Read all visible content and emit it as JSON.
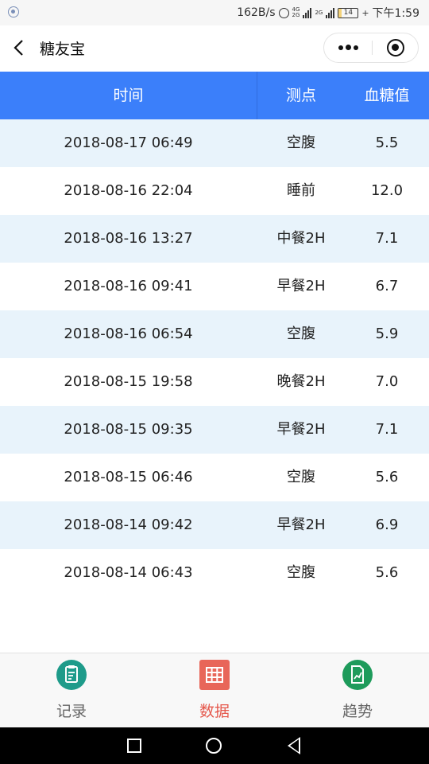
{
  "status_bar": {
    "speed": "162B/s",
    "net_top": "4G",
    "net_bottom": "2G",
    "signal_label": "2G",
    "battery": "14",
    "battery_level": 0.14,
    "time": "下午1:59"
  },
  "header": {
    "title": "糖友宝"
  },
  "table": {
    "columns": [
      "时间",
      "测点",
      "血糖值"
    ],
    "rows": [
      {
        "time": "2018-08-17 06:49",
        "point": "空腹",
        "value": "5.5"
      },
      {
        "time": "2018-08-16 22:04",
        "point": "睡前",
        "value": "12.0"
      },
      {
        "time": "2018-08-16 13:27",
        "point": "中餐2H",
        "value": "7.1"
      },
      {
        "time": "2018-08-16 09:41",
        "point": "早餐2H",
        "value": "6.7"
      },
      {
        "time": "2018-08-16 06:54",
        "point": "空腹",
        "value": "5.9"
      },
      {
        "time": "2018-08-15 19:58",
        "point": "晚餐2H",
        "value": "7.0"
      },
      {
        "time": "2018-08-15 09:35",
        "point": "早餐2H",
        "value": "7.1"
      },
      {
        "time": "2018-08-15 06:46",
        "point": "空腹",
        "value": "5.6"
      },
      {
        "time": "2018-08-14 09:42",
        "point": "早餐2H",
        "value": "6.9"
      },
      {
        "time": "2018-08-14 06:43",
        "point": "空腹",
        "value": "5.6"
      }
    ]
  },
  "tabbar": {
    "items": [
      {
        "label": "记录",
        "icon": "clipboard-icon",
        "active": false
      },
      {
        "label": "数据",
        "icon": "grid-table-icon",
        "active": true
      },
      {
        "label": "趋势",
        "icon": "chart-document-icon",
        "active": false
      }
    ]
  },
  "colors": {
    "header_blue": "#3b7ffa",
    "row_tint": "#e8f3fb",
    "active_tab": "#e5584c",
    "teal": "#1e9b8a",
    "green": "#1e9b5b"
  }
}
